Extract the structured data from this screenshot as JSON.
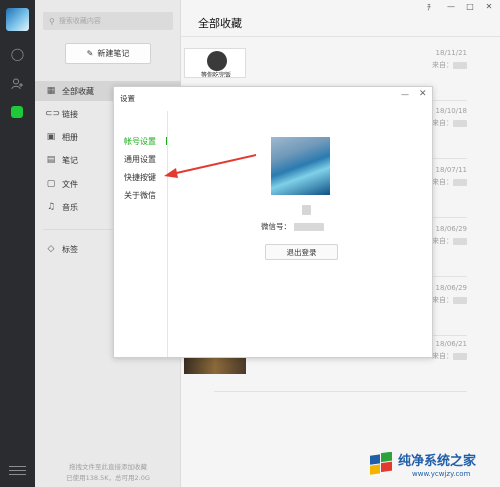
{
  "app": {
    "search_placeholder": "搜索收藏内容",
    "new_note_label": "新建笔记",
    "nav_icons": [
      "chat-icon",
      "contacts-icon",
      "favorites-icon",
      "menu-icon"
    ]
  },
  "sidebar": {
    "items": [
      {
        "label": "全部收藏",
        "icon": "grid-icon"
      },
      {
        "label": "链接",
        "icon": "link-icon"
      },
      {
        "label": "相册",
        "icon": "image-icon"
      },
      {
        "label": "笔记",
        "icon": "note-icon"
      },
      {
        "label": "文件",
        "icon": "file-icon"
      },
      {
        "label": "音乐",
        "icon": "music-icon"
      },
      {
        "label": "标签",
        "icon": "tag-icon"
      }
    ],
    "drop_hint": "拖拽文件至此直接添加收藏",
    "storage": "已使用138.5K，总可用2.0G"
  },
  "main": {
    "title": "全部收藏",
    "meme_caption": "等你吃完饭",
    "favorites": [
      {
        "date": "18/11/21",
        "source": "来自："
      },
      {
        "date": "18/10/18",
        "source": "来自："
      },
      {
        "date": "18/07/11",
        "source": "来自："
      },
      {
        "date": "18/06/29",
        "source": "来自："
      },
      {
        "date": "18/06/29",
        "source": "来自："
      },
      {
        "date": "18/06/21",
        "source": "来自："
      }
    ]
  },
  "window": {
    "pin": "ﾁ",
    "minimize": "—",
    "maximize": "□",
    "close": "✕"
  },
  "dialog": {
    "title": "设置",
    "minimize": "—",
    "close": "✕",
    "nav": [
      "帐号设置",
      "通用设置",
      "快捷按键",
      "关于微信"
    ],
    "active_nav": "帐号设置",
    "wechat_id_label": "微信号：",
    "logout_label": "退出登录"
  },
  "watermark": {
    "title": "纯净系统之家",
    "url": "www.ycwjzy.com"
  },
  "colors": {
    "accent_green": "#1aad19",
    "nav_dark": "#2b2c2f"
  }
}
